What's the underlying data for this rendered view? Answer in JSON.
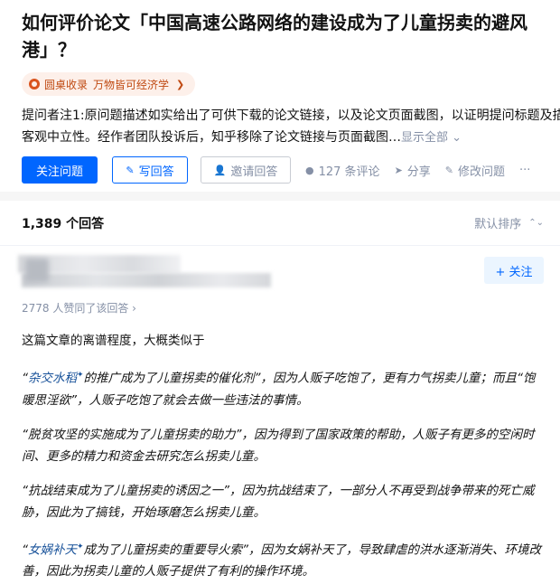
{
  "question": {
    "title": "如何评价论文「中国高速公路网络的建设成为了儿童拐卖的避风港」？",
    "roundtable": {
      "icon": "roundtable-icon",
      "name": "圆桌收录",
      "sub": "万物皆可经济学",
      "arrow": "❯"
    },
    "description": "提问者注1:原问题描述如实给出了可供下载的论文链接，以及论文页面截图，以证明提问标题及描述的客观中立性。经作者团队投诉后，知乎移除了论文链接与页面截图…",
    "description_line1": "提问者注1:原问题描述如实给出了可供下载的论文链接，以及论文页面截图，以证明提问标题及描述的",
    "description_line2": "客观中立性。经作者团队投诉后，知乎移除了论文链接与页面截图…",
    "show_all": "显示全部",
    "actions": {
      "follow": "关注问题",
      "write": "写回答",
      "invite": "邀请回答",
      "comments": "127 条评论",
      "share": "分享",
      "edit": "修改问题",
      "more": "···"
    }
  },
  "answers": {
    "count": "1,389 个回答",
    "sort": "默认排序",
    "first": {
      "follow_label": "+ 关注",
      "votes": "2778 人赞同了该回答 ›",
      "intro": "这篇文章的离谱程度，大概类似于",
      "p1_pre": "“",
      "p1_link": "杂交水稻",
      "p1_mid": "的推广成为了儿童拐卖的催化剂”，因为人贩子吃饱了，更有力气拐卖儿童；而且“饱暖思淫欲”，人贩子吃饱了就会去做一些违法的事情。",
      "p2": "“脱贫攻坚的实施成为了儿童拐卖的助力”，因为得到了国家政策的帮助，人贩子有更多的空闲时间、更多的精力和资金去研究怎么拐卖儿童。",
      "p3": "“抗战结束成为了儿童拐卖的诱因之一”，因为抗战结束了，一部分人不再受到战争带来的死亡威胁，因此为了搞钱，开始琢磨怎么拐卖儿童。",
      "p4_pre": "“",
      "p4_link": "女娲补天",
      "p4_mid": "成为了儿童拐卖的重要导火索”，因为女娲补天了，导致肆虐的洪水逐渐消失、环境改善，因此为拐卖儿童的人贩子提供了有利的操作环境。",
      "sup": "✦"
    }
  }
}
